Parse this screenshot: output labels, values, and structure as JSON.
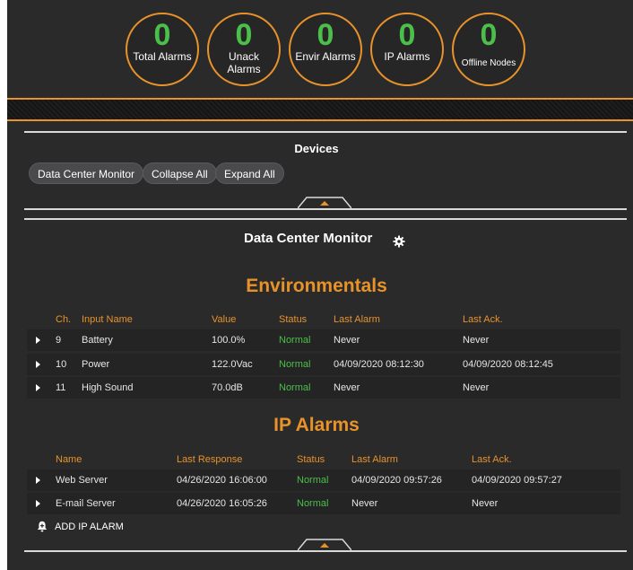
{
  "counters": [
    {
      "value": "0",
      "label": "Total Alarms"
    },
    {
      "value": "0",
      "label": "Unack Alarms"
    },
    {
      "value": "0",
      "label": "Envir Alarms"
    },
    {
      "value": "0",
      "label": "IP Alarms"
    },
    {
      "value": "0",
      "label": "Offline Nodes"
    }
  ],
  "devices": {
    "title": "Devices",
    "buttons": [
      "Data Center Monitor",
      "Collapse All",
      "Expand All"
    ]
  },
  "monitor": {
    "title": "Data Center Monitor",
    "icon": "gear-icon"
  },
  "environmentals": {
    "title": "Environmentals",
    "headers": [
      "Ch.",
      "Input Name",
      "Value",
      "Status",
      "Last Alarm",
      "Last Ack."
    ],
    "rows": [
      {
        "ch": "9",
        "name": "Battery",
        "value": "100.0%",
        "status": "Normal",
        "last_alarm": "Never",
        "last_ack": "Never"
      },
      {
        "ch": "10",
        "name": "Power",
        "value": "122.0Vac",
        "status": "Normal",
        "last_alarm": "04/09/2020 08:12:30",
        "last_ack": "04/09/2020 08:12:45"
      },
      {
        "ch": "11",
        "name": "High Sound",
        "value": "70.0dB",
        "status": "Normal",
        "last_alarm": "Never",
        "last_ack": "Never"
      }
    ]
  },
  "ip_alarms": {
    "title": "IP Alarms",
    "headers": [
      "Name",
      "Last Response",
      "Status",
      "Last Alarm",
      "Last Ack."
    ],
    "rows": [
      {
        "name": "Web Server",
        "last_response": "04/26/2020 16:06:00",
        "status": "Normal",
        "last_alarm": "04/09/2020 09:57:26",
        "last_ack": "04/09/2020 09:57:27"
      },
      {
        "name": "E-mail Server",
        "last_response": "04/26/2020 16:05:26",
        "status": "Normal",
        "last_alarm": "Never",
        "last_ack": "Never"
      }
    ],
    "add_label": "ADD IP ALARM"
  },
  "colors": {
    "accent": "#e8922a",
    "ok": "#4cbf4a",
    "panel": "#2a2a2b"
  }
}
